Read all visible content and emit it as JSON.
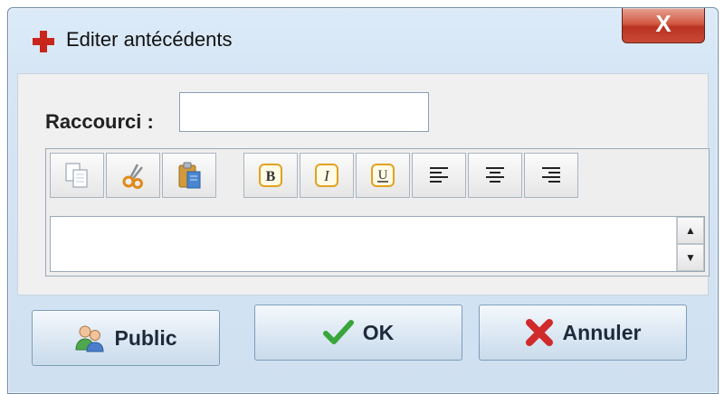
{
  "window": {
    "title": "Editer antécédents",
    "close_glyph": "X",
    "title_icon": "red-cross-icon"
  },
  "form": {
    "shortcut_label": "Raccourci :",
    "shortcut_value": ""
  },
  "toolbar": {
    "buttons": [
      {
        "name": "copy",
        "icon": "copy-icon"
      },
      {
        "name": "cut",
        "icon": "scissors-icon"
      },
      {
        "name": "paste",
        "icon": "clipboard-icon"
      },
      {
        "name": "bold",
        "icon": "bold-icon",
        "glyph": "B"
      },
      {
        "name": "italic",
        "icon": "italic-icon",
        "glyph": "I"
      },
      {
        "name": "underline",
        "icon": "underline-icon",
        "glyph": "U"
      },
      {
        "name": "align-left",
        "icon": "align-left-icon"
      },
      {
        "name": "align-center",
        "icon": "align-center-icon"
      },
      {
        "name": "align-right",
        "icon": "align-right-icon"
      }
    ]
  },
  "editor": {
    "text": ""
  },
  "scrollbar": {
    "up": "▲",
    "down": "▼"
  },
  "buttons": {
    "public_label": "Public",
    "ok_label": "OK",
    "cancel_label": "Annuler"
  },
  "colors": {
    "accent_red": "#c8251c",
    "ok_green": "#3aa53a",
    "cancel_red": "#d02a2a",
    "format_orange": "#e0a21f"
  }
}
